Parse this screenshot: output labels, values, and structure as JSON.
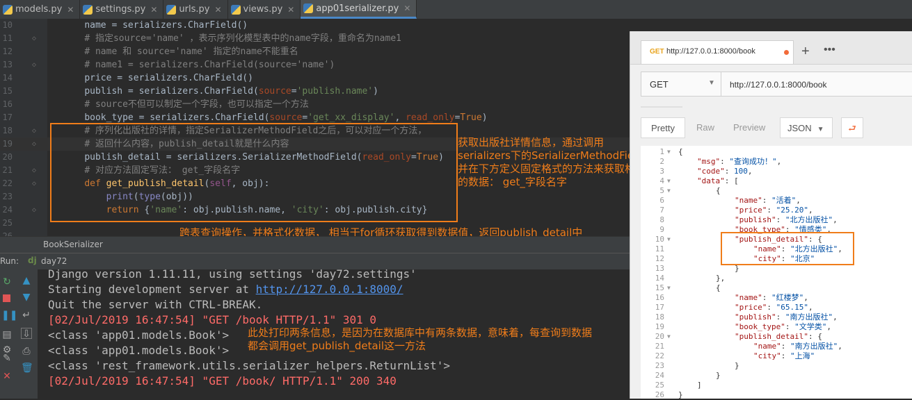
{
  "tabs": [
    {
      "label": "models.py",
      "active": false
    },
    {
      "label": "settings.py",
      "active": false
    },
    {
      "label": "urls.py",
      "active": false
    },
    {
      "label": "views.py",
      "active": false
    },
    {
      "label": "app01serializer.py",
      "active": true
    }
  ],
  "editor": {
    "lines": [
      {
        "num": "10",
        "indent": "    ",
        "parts": [
          [
            "",
            "name = serializers.CharField()"
          ]
        ]
      },
      {
        "num": "11",
        "indent": "    ",
        "parts": [
          [
            "cm",
            "# 指定source='name' ，表示序列化模型表中的name字段，重命名为name1"
          ]
        ]
      },
      {
        "num": "12",
        "indent": "    ",
        "parts": [
          [
            "cm",
            "# name 和 source='name' 指定的name不能重名"
          ]
        ]
      },
      {
        "num": "13",
        "indent": "    ",
        "parts": [
          [
            "cm",
            "# name1 = serializers.CharField(source='name')"
          ]
        ]
      },
      {
        "num": "14",
        "indent": "    ",
        "parts": [
          [
            "",
            "price = serializers.CharField()"
          ]
        ]
      },
      {
        "num": "15",
        "indent": "    ",
        "parts": [
          [
            "",
            "publish = serializers.CharField("
          ],
          [
            "prm",
            "source"
          ],
          [
            "",
            "="
          ],
          [
            "str",
            "'publish.name'"
          ],
          [
            "",
            ")"
          ]
        ]
      },
      {
        "num": "16",
        "indent": "    ",
        "parts": [
          [
            "cm",
            "# source不但可以制定一个字段，也可以指定一个方法"
          ]
        ]
      },
      {
        "num": "17",
        "indent": "    ",
        "parts": [
          [
            "",
            "book_type = serializers.CharField("
          ],
          [
            "prm",
            "source"
          ],
          [
            "",
            "="
          ],
          [
            "str",
            "'get_xx_display'"
          ],
          [
            "",
            ", "
          ],
          [
            "prm",
            "read_only"
          ],
          [
            "",
            "="
          ],
          [
            "kw",
            "True"
          ],
          [
            "",
            ")"
          ]
        ]
      },
      {
        "num": "18",
        "indent": "    ",
        "parts": [
          [
            "cm",
            "# 序列化出版社的详情，指定SerializerMethodField之后，可以对应一个方法，"
          ]
        ]
      },
      {
        "num": "19",
        "indent": "    ",
        "parts": [
          [
            "cm",
            "# 返回什么内容，publish_detail就是什么内容"
          ]
        ]
      },
      {
        "num": "20",
        "indent": "    ",
        "parts": [
          [
            "",
            "publish_detail = serializers.SerializerMethodField("
          ],
          [
            "prm",
            "read_only"
          ],
          [
            "",
            "="
          ],
          [
            "kw",
            "True"
          ],
          [
            "",
            ")"
          ]
        ]
      },
      {
        "num": "21",
        "indent": "    ",
        "parts": [
          [
            "cm",
            "# 对应方法固定写法： get_字段名字"
          ]
        ]
      },
      {
        "num": "22",
        "indent": "    ",
        "parts": [
          [
            "kw",
            "def "
          ],
          [
            "fn",
            "get_publish_detail"
          ],
          [
            "",
            "("
          ],
          [
            "self",
            "self"
          ],
          [
            "",
            ", obj):"
          ]
        ]
      },
      {
        "num": "23",
        "indent": "        ",
        "parts": [
          [
            "bi",
            "print"
          ],
          [
            "",
            "("
          ],
          [
            "bi",
            "type"
          ],
          [
            "",
            "(obj))"
          ]
        ]
      },
      {
        "num": "24",
        "indent": "        ",
        "parts": [
          [
            "kw",
            "return "
          ],
          [
            "",
            "{"
          ],
          [
            "str",
            "'name'"
          ],
          [
            "",
            ": obj.publish.name, "
          ],
          [
            "str",
            "'city'"
          ],
          [
            "",
            ": obj.publish.city}"
          ]
        ]
      },
      {
        "num": "25",
        "indent": "",
        "parts": [
          [
            "",
            ""
          ]
        ]
      },
      {
        "num": "26",
        "indent": "",
        "parts": [
          [
            "",
            ""
          ]
        ]
      }
    ]
  },
  "annotations": {
    "right_1": "获取出版社详情信息，通过调用",
    "right_2": "serializers下的SerializerMethodField方法",
    "right_3": "并在下方定义固定格式的方法来获取格式化",
    "right_4": "的数据： get_字段名字",
    "bottom": "跨表查询操作，并格式化数据， 相当于for循环获取得到数据值，返回publish_detail中",
    "console_1": "此处打印两条信息，是因为在数据库中有两条数据，意味着，每查询到数据",
    "console_2": "都会调用get_publish_detail这一方法"
  },
  "structure": {
    "label": "BookSerializer"
  },
  "run": {
    "label": "Run:",
    "config": "day72",
    "dj_icon": "dj"
  },
  "console": {
    "lines": [
      {
        "text": "Django version 1.11.11, using settings 'day72.settings'",
        "red": false
      },
      {
        "text": "Starting development server at ",
        "link": "http://127.0.0.1:8000/",
        "red": false
      },
      {
        "text": "Quit the server with CTRL-BREAK.",
        "red": false
      },
      {
        "text": "[02/Jul/2019 16:47:54] \"GET /book HTTP/1.1\" 301 0",
        "red": true
      },
      {
        "text": "<class 'app01.models.Book'>",
        "red": false
      },
      {
        "text": "<class 'app01.models.Book'>",
        "red": false
      },
      {
        "text": "<class 'rest_framework.utils.serializer_helpers.ReturnList'>",
        "red": false
      },
      {
        "text": "[02/Jul/2019 16:47:54] \"GET /book/ HTTP/1.1\" 200 340",
        "red": true
      }
    ]
  },
  "postman": {
    "tab_method": "GET",
    "tab_url": "http://127.0.0.1:8000/book",
    "method": "GET",
    "url": "http://127.0.0.1:8000/book",
    "views": [
      "Pretty",
      "Raw",
      "Preview"
    ],
    "format": "JSON",
    "json_lines": [
      {
        "n": "1",
        "fold": true,
        "d": 0,
        "p": [
          [
            "",
            "{"
          ]
        ]
      },
      {
        "n": "2",
        "d": 1,
        "p": [
          [
            "k",
            "\"msg\""
          ],
          [
            "",
            ": "
          ],
          [
            "v",
            "\"查询成功！\""
          ],
          [
            "",
            ","
          ]
        ]
      },
      {
        "n": "3",
        "d": 1,
        "p": [
          [
            "k",
            "\"code\""
          ],
          [
            "",
            ": "
          ],
          [
            "v",
            "100"
          ],
          [
            "",
            ","
          ]
        ]
      },
      {
        "n": "4",
        "fold": true,
        "d": 1,
        "p": [
          [
            "k",
            "\"data\""
          ],
          [
            "",
            ": ["
          ]
        ]
      },
      {
        "n": "5",
        "fold": true,
        "d": 2,
        "p": [
          [
            "",
            "{"
          ]
        ]
      },
      {
        "n": "6",
        "d": 3,
        "p": [
          [
            "k",
            "\"name\""
          ],
          [
            "",
            ": "
          ],
          [
            "v",
            "\"活着\""
          ],
          [
            "",
            ","
          ]
        ]
      },
      {
        "n": "7",
        "d": 3,
        "p": [
          [
            "k",
            "\"price\""
          ],
          [
            "",
            ": "
          ],
          [
            "v",
            "\"25.20\""
          ],
          [
            "",
            ","
          ]
        ]
      },
      {
        "n": "8",
        "d": 3,
        "p": [
          [
            "k",
            "\"publish\""
          ],
          [
            "",
            ": "
          ],
          [
            "v",
            "\"北方出版社\""
          ],
          [
            "",
            ","
          ]
        ]
      },
      {
        "n": "9",
        "d": 3,
        "p": [
          [
            "k",
            "\"book_type\""
          ],
          [
            "",
            ": "
          ],
          [
            "v",
            "\"情感类\""
          ],
          [
            "",
            ","
          ]
        ]
      },
      {
        "n": "10",
        "fold": true,
        "d": 3,
        "p": [
          [
            "k",
            "\"publish_detail\""
          ],
          [
            "",
            ": {"
          ]
        ]
      },
      {
        "n": "11",
        "d": 4,
        "p": [
          [
            "k",
            "\"name\""
          ],
          [
            "",
            ": "
          ],
          [
            "v",
            "\"北方出版社\""
          ],
          [
            "",
            ","
          ]
        ]
      },
      {
        "n": "12",
        "d": 4,
        "p": [
          [
            "k",
            "\"city\""
          ],
          [
            "",
            ": "
          ],
          [
            "v",
            "\"北京\""
          ]
        ]
      },
      {
        "n": "13",
        "d": 3,
        "p": [
          [
            "",
            "}"
          ]
        ]
      },
      {
        "n": "14",
        "d": 2,
        "p": [
          [
            "",
            "},"
          ]
        ]
      },
      {
        "n": "15",
        "fold": true,
        "d": 2,
        "p": [
          [
            "",
            "{"
          ]
        ]
      },
      {
        "n": "16",
        "d": 3,
        "p": [
          [
            "k",
            "\"name\""
          ],
          [
            "",
            ": "
          ],
          [
            "v",
            "\"红楼梦\""
          ],
          [
            "",
            ","
          ]
        ]
      },
      {
        "n": "17",
        "d": 3,
        "p": [
          [
            "k",
            "\"price\""
          ],
          [
            "",
            ": "
          ],
          [
            "v",
            "\"65.15\""
          ],
          [
            "",
            ","
          ]
        ]
      },
      {
        "n": "18",
        "d": 3,
        "p": [
          [
            "k",
            "\"publish\""
          ],
          [
            "",
            ": "
          ],
          [
            "v",
            "\"南方出版社\""
          ],
          [
            "",
            ","
          ]
        ]
      },
      {
        "n": "19",
        "d": 3,
        "p": [
          [
            "k",
            "\"book_type\""
          ],
          [
            "",
            ": "
          ],
          [
            "v",
            "\"文学类\""
          ],
          [
            "",
            ","
          ]
        ]
      },
      {
        "n": "20",
        "fold": true,
        "d": 3,
        "p": [
          [
            "k",
            "\"publish_detail\""
          ],
          [
            "",
            ": {"
          ]
        ]
      },
      {
        "n": "21",
        "d": 4,
        "p": [
          [
            "k",
            "\"name\""
          ],
          [
            "",
            ": "
          ],
          [
            "v",
            "\"南方出版社\""
          ],
          [
            "",
            ","
          ]
        ]
      },
      {
        "n": "22",
        "d": 4,
        "p": [
          [
            "k",
            "\"city\""
          ],
          [
            "",
            ": "
          ],
          [
            "v",
            "\"上海\""
          ]
        ]
      },
      {
        "n": "23",
        "d": 3,
        "p": [
          [
            "",
            "}"
          ]
        ]
      },
      {
        "n": "24",
        "d": 2,
        "p": [
          [
            "",
            "}"
          ]
        ]
      },
      {
        "n": "25",
        "d": 1,
        "p": [
          [
            "",
            "]"
          ]
        ]
      },
      {
        "n": "26",
        "d": 0,
        "p": [
          [
            "",
            "}"
          ]
        ]
      }
    ]
  },
  "colors": {
    "annotation": "#f07d1a",
    "accent": "#4a88c7",
    "error": "#ff6b68"
  }
}
